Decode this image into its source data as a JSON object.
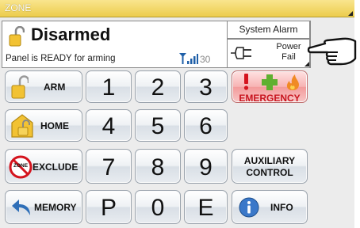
{
  "header": {
    "zone_label": "ZONE"
  },
  "status": {
    "state": "Disarmed",
    "ready_text": "Panel is READY for arming",
    "signal_value": "30"
  },
  "alerts": {
    "system_alarm": "System Alarm",
    "power_fail": "Power Fail"
  },
  "keys": {
    "arm": "ARM",
    "home": "HOME",
    "exclude": "EXCLUDE",
    "zone_badge": "ZONE",
    "memory": "MEMORY",
    "emergency": "EMERGENCY",
    "auxiliary": "AUXILIARY CONTROL",
    "info": "INFO",
    "digits": [
      "1",
      "2",
      "3",
      "4",
      "5",
      "6",
      "7",
      "8",
      "9",
      "P",
      "0",
      "E"
    ]
  },
  "colors": {
    "zone_bar": "#f2d86a",
    "emergency_text": "#c8141e",
    "info_blue": "#3a78c9"
  }
}
